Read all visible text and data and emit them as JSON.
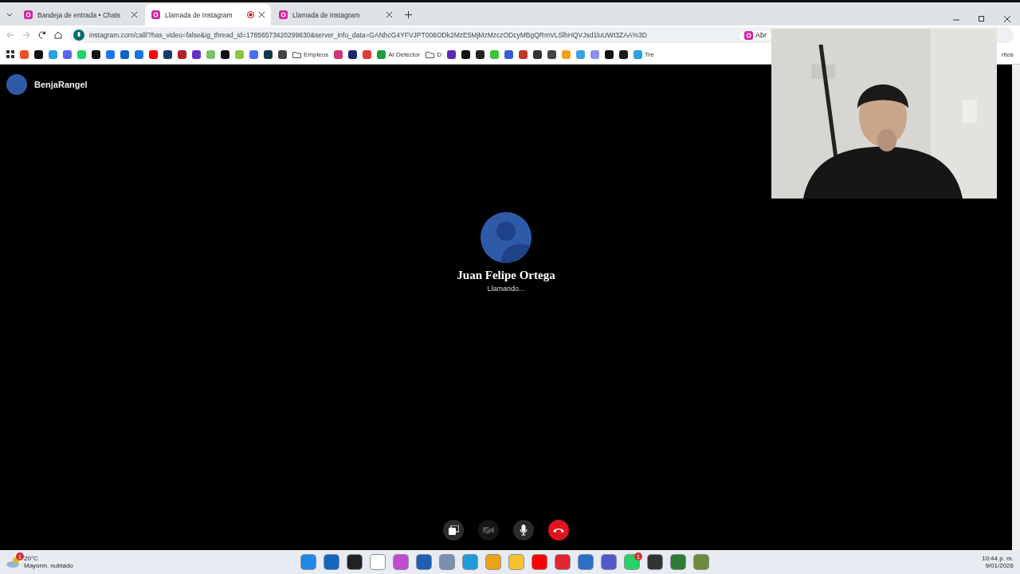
{
  "tabs": [
    {
      "title": "Bandeja de entrada • Chats",
      "selected": false,
      "recording": false
    },
    {
      "title": "Llamada de Instagram",
      "selected": true,
      "recording": true
    },
    {
      "title": "Llamada de Instagram",
      "selected": false,
      "recording": false
    }
  ],
  "address": {
    "url": "instagram.com/call/?has_video=false&ig_thread_id=17856573420299630&server_info_data=GANhcG4YFVJPT006ODk2MzE5MjMzMzczODcyMBgQRmVLSlhHQVJsd1luUWt3ZAA%3D",
    "side_chip": "Abr"
  },
  "bookmarks": [
    {
      "kind": "icon",
      "color": "#f25022"
    },
    {
      "kind": "icon",
      "color": "#111111"
    },
    {
      "kind": "icon",
      "color": "#2aa3df"
    },
    {
      "kind": "icon",
      "color": "#5865f2"
    },
    {
      "kind": "icon",
      "color": "#25d366"
    },
    {
      "kind": "icon",
      "color": "#111111"
    },
    {
      "kind": "icon",
      "color": "#1877f2"
    },
    {
      "kind": "icon",
      "color": "#0a66c2"
    },
    {
      "kind": "icon",
      "color": "#1b74d8"
    },
    {
      "kind": "icon",
      "color": "#ff0000"
    },
    {
      "kind": "icon",
      "color": "#163a6b"
    },
    {
      "kind": "icon",
      "color": "#b3202a"
    },
    {
      "kind": "icon",
      "color": "#6a2cc9"
    },
    {
      "kind": "icon",
      "color": "#7fbf6a"
    },
    {
      "kind": "icon",
      "color": "#111111"
    },
    {
      "kind": "icon",
      "color": "#8cc63f"
    },
    {
      "kind": "icon",
      "color": "#4a6cf7"
    },
    {
      "kind": "icon",
      "color": "#0e3b43"
    },
    {
      "kind": "icon",
      "color": "#444444"
    },
    {
      "kind": "folder",
      "label": "Empleos"
    },
    {
      "kind": "icon",
      "color": "#d9327a"
    },
    {
      "kind": "icon",
      "color": "#1a2b6b"
    },
    {
      "kind": "icon",
      "color": "#e53935"
    },
    {
      "kind": "labeled",
      "color": "#1e9e3a",
      "label": "AI Detector"
    },
    {
      "kind": "folder",
      "label": "D"
    },
    {
      "kind": "icon",
      "color": "#5b2bb5"
    },
    {
      "kind": "icon",
      "color": "#111111"
    },
    {
      "kind": "icon",
      "color": "#222222"
    },
    {
      "kind": "icon",
      "color": "#3cc43c"
    },
    {
      "kind": "icon",
      "color": "#3b5bdb"
    },
    {
      "kind": "icon",
      "color": "#c0392b"
    },
    {
      "kind": "icon",
      "color": "#333333"
    },
    {
      "kind": "icon",
      "color": "#444444"
    },
    {
      "kind": "icon",
      "color": "#f0a020"
    },
    {
      "kind": "icon",
      "color": "#3fa0e0"
    },
    {
      "kind": "icon",
      "color": "#8e8ef0"
    },
    {
      "kind": "icon",
      "color": "#111111"
    },
    {
      "kind": "icon",
      "color": "#1a1a1a"
    },
    {
      "kind": "labeled",
      "color": "#2aa3df",
      "label": "Tre"
    }
  ],
  "bookmarks_end": "ritos",
  "caller": {
    "name": "BenjaRangel"
  },
  "callee": {
    "name": "Juan Felipe Ortega",
    "status": "Llamando..."
  },
  "controls": [
    {
      "kind": "share",
      "disabled": false
    },
    {
      "kind": "camera",
      "disabled": true
    },
    {
      "kind": "mic",
      "disabled": false
    },
    {
      "kind": "hangup",
      "disabled": false
    }
  ],
  "weather": {
    "temp": "20°C",
    "desc": "Mayorm. nublado",
    "badge": "1"
  },
  "taskbar": [
    {
      "color": "#1e88e5"
    },
    {
      "color": "#1565c0"
    },
    {
      "color": "#222222"
    },
    {
      "color": "#ffffff"
    },
    {
      "color": "#c04ad0"
    },
    {
      "color": "#1e5fb4"
    },
    {
      "color": "#7b8fb0"
    },
    {
      "color": "#1f9bd7"
    },
    {
      "color": "#e8a317"
    },
    {
      "color": "#f4c430"
    },
    {
      "color": "#ff0000"
    },
    {
      "color": "#e3262e"
    },
    {
      "color": "#2b6fc7"
    },
    {
      "color": "#5059c9"
    },
    {
      "color": "#25d366",
      "badge": "1"
    },
    {
      "color": "#333333"
    },
    {
      "color": "#2e7d32"
    },
    {
      "color": "#6d8b3a"
    }
  ],
  "clock": {
    "time": "10:44 p. m.",
    "date": "9/01/2026"
  }
}
